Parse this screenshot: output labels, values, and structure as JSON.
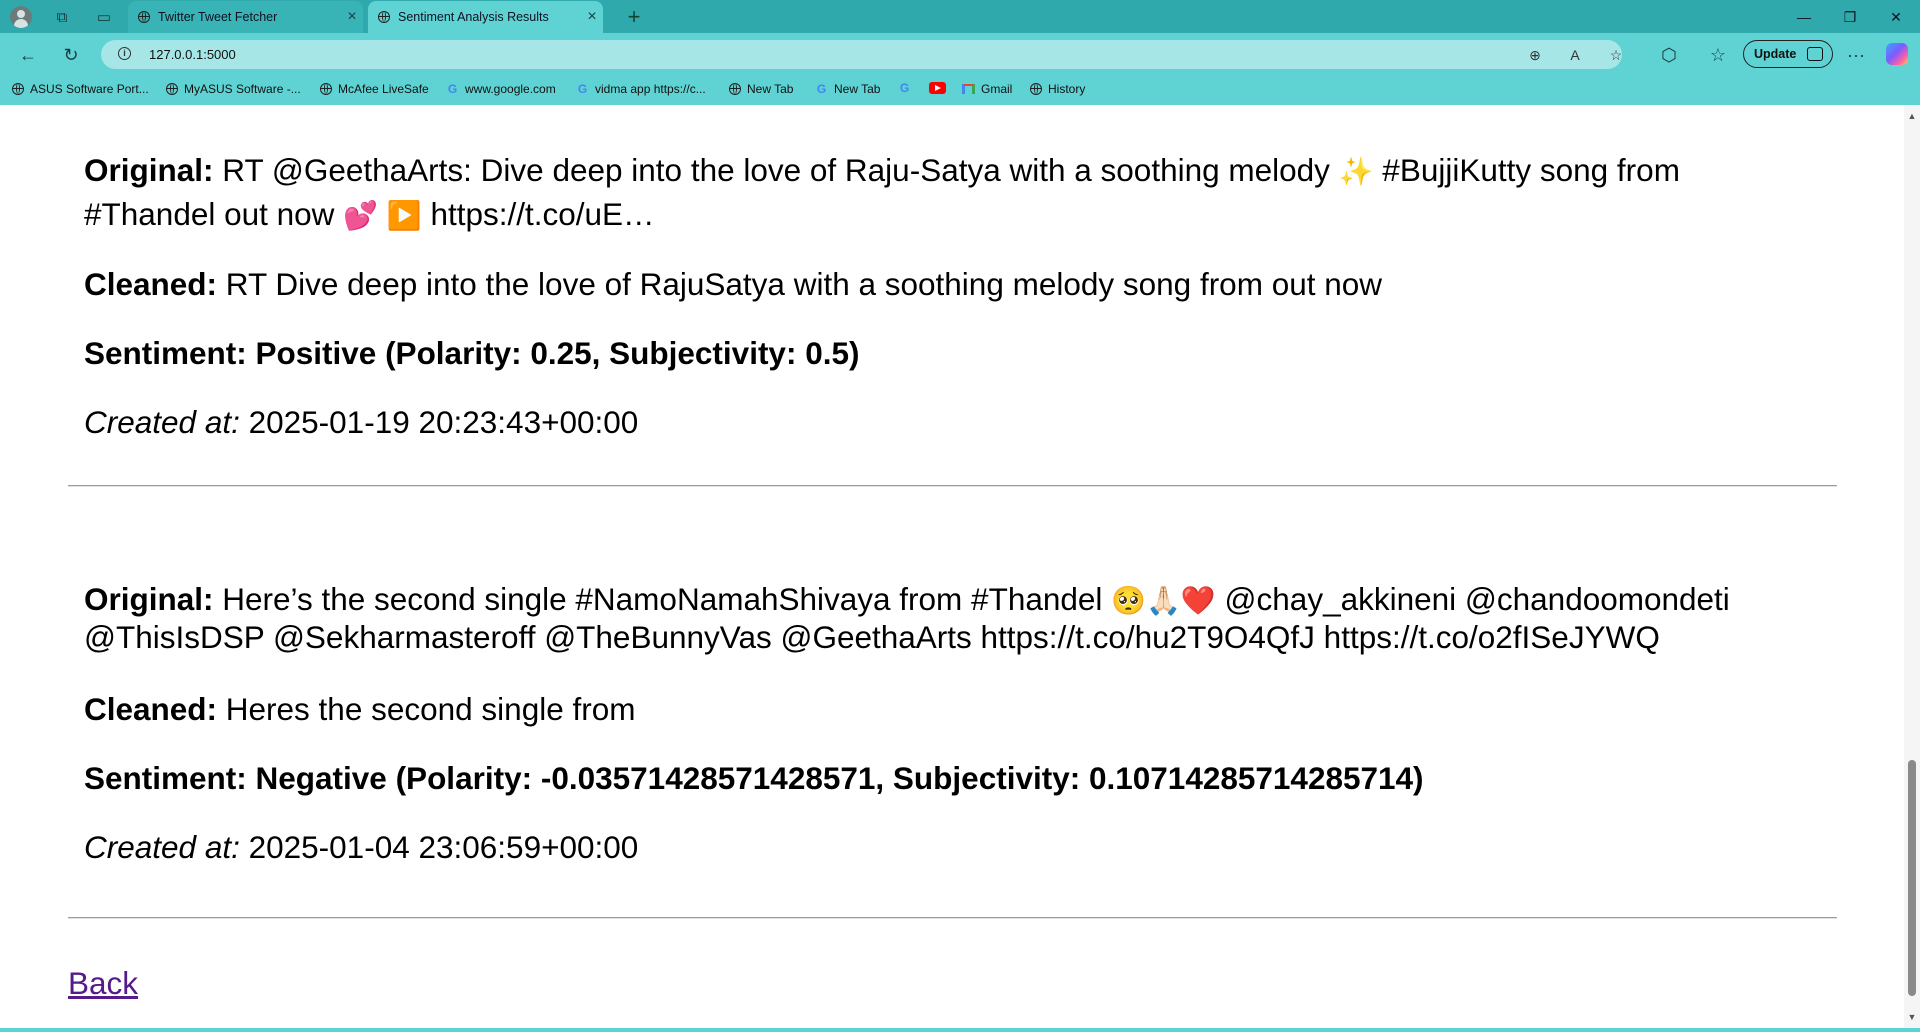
{
  "browser": {
    "tabs": [
      {
        "title": "Twitter Tweet Fetcher",
        "active": false
      },
      {
        "title": "Sentiment Analysis Results",
        "active": true
      }
    ],
    "address_url": "127.0.0.1:5000",
    "update_label": "Update",
    "bookmarks": [
      {
        "label": "ASUS Software Port...",
        "icon": "globe-icon"
      },
      {
        "label": "MyASUS Software -...",
        "icon": "globe-icon"
      },
      {
        "label": "McAfee LiveSafe",
        "icon": "globe-icon"
      },
      {
        "label": "www.google.com",
        "icon": "google-icon"
      },
      {
        "label": "vidma app https://c...",
        "icon": "google-icon"
      },
      {
        "label": "New Tab",
        "icon": "globe-icon"
      },
      {
        "label": "New Tab",
        "icon": "google-icon"
      },
      {
        "label": "",
        "icon": "google-icon"
      },
      {
        "label": "",
        "icon": "youtube-icon"
      },
      {
        "label": "Gmail",
        "icon": "gmail-icon"
      },
      {
        "label": "History",
        "icon": "globe-icon"
      }
    ]
  },
  "page": {
    "labels": {
      "original": "Original:",
      "cleaned": "Cleaned:",
      "created_at": "Created at:"
    },
    "tweets": [
      {
        "original_part1": " RT @GeethaArts: Dive deep into the love of Raju-Satya with a soothing melody ",
        "emoji_a": "✨",
        "original_part2": " #BujjiKutty song from #Thandel out now ",
        "emoji_b": "💕",
        "emoji_c": "▶️",
        "original_part3": " https://t.co/uE…",
        "cleaned": " RT Dive deep into the love of RajuSatya with a soothing melody song from out now",
        "sentiment": "Sentiment: Positive (Polarity: 0.25, Subjectivity: 0.5)",
        "created_at": " 2025-01-19 20:23:43+00:00"
      },
      {
        "original_part1": " Here’s the second single #NamoNamahShivaya from #Thandel ",
        "emoji_a": "🥺",
        "emoji_b": "🙏🏻",
        "emoji_c": "❤️",
        "original_part2": " @chay_akkineni @chandoomondeti @ThisIsDSP @Sekharmasteroff @TheBunnyVas @GeethaArts https://t.co/hu2T9O4QfJ https://t.co/o2fISeJYWQ",
        "cleaned": " Heres the second single from",
        "sentiment": "Sentiment: Negative (Polarity: -0.03571428571428571, Subjectivity: 0.10714285714285714)",
        "created_at": " 2025-01-04 23:06:59+00:00"
      }
    ],
    "back_link": "Back"
  }
}
